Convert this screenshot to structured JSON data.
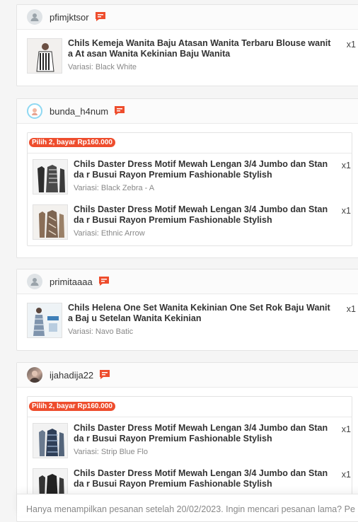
{
  "colors": {
    "accent": "#ee4d2d",
    "chat": "#ee4d2d"
  },
  "orders": [
    {
      "username": "pfimjktsor",
      "avatar_icon": "user-placeholder-icon",
      "items": [
        {
          "title": "Chils Kemeja Wanita Baju Atasan Wanita Terbaru Blouse wanita At asan Wanita Kekinian Baju Wanita",
          "variant": "Variasi: Black White",
          "qty": "x1"
        }
      ]
    },
    {
      "username": "bunda_h4num",
      "avatar_icon": "user-avatar-icon",
      "bundle_label": "Pilih 2, bayar Rp160.000",
      "items": [
        {
          "title": "Chils Daster Dress Motif Mewah Lengan 3/4 Jumbo dan Standa r Busui Rayon Premium Fashionable Stylish",
          "variant": "Variasi: Black Zebra - A",
          "qty": "x1"
        },
        {
          "title": "Chils Daster Dress Motif Mewah Lengan 3/4 Jumbo dan Standa r Busui Rayon Premium Fashionable Stylish",
          "variant": "Variasi: Ethnic Arrow",
          "qty": "x1"
        }
      ]
    },
    {
      "username": "primitaaaa",
      "avatar_icon": "user-placeholder-icon",
      "items": [
        {
          "title": "Chils Helena One Set Wanita Kekinian One Set Rok Baju Wanita Baj u Setelan Wanita Kekinian",
          "variant": "Variasi: Navo Batic",
          "qty": "x1"
        }
      ]
    },
    {
      "username": "ijahadija22",
      "avatar_icon": "user-photo-icon",
      "bundle_label": "Pilih 2, bayar Rp160.000",
      "items": [
        {
          "title": "Chils Daster Dress Motif Mewah Lengan 3/4 Jumbo dan Standa r Busui Rayon Premium Fashionable Stylish",
          "variant": "Variasi: Strip Blue Flo",
          "qty": "x1"
        },
        {
          "title": "Chils Daster Dress Motif Mewah Lengan 3/4 Jumbo dan Standa r Busui Rayon Premium Fashionable Stylish",
          "variant": "",
          "qty": "x1"
        }
      ]
    }
  ],
  "footer": {
    "notice": "Hanya menampilkan pesanan setelah 20/02/2023. Ingin mencari pesanan lama? Pe"
  }
}
